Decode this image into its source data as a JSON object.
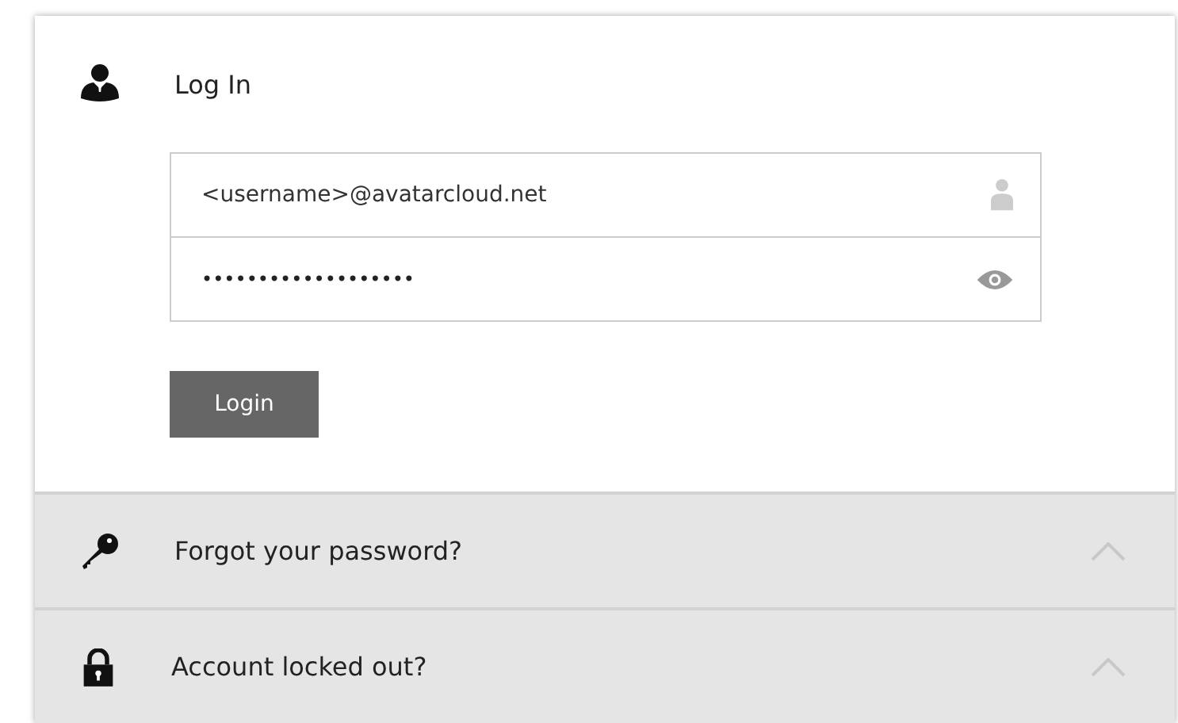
{
  "login": {
    "title": "Log In",
    "fields": [
      {
        "kind": "user",
        "value": "<username>@avatarcloud.net"
      },
      {
        "kind": "password",
        "value": "•••••••••••••••••••"
      }
    ],
    "button": "Login"
  },
  "sections": [
    {
      "kind": "key",
      "label": "Forgot your password?",
      "expanded": false
    },
    {
      "kind": "lock",
      "label": "Account locked out?",
      "expanded": false
    }
  ]
}
